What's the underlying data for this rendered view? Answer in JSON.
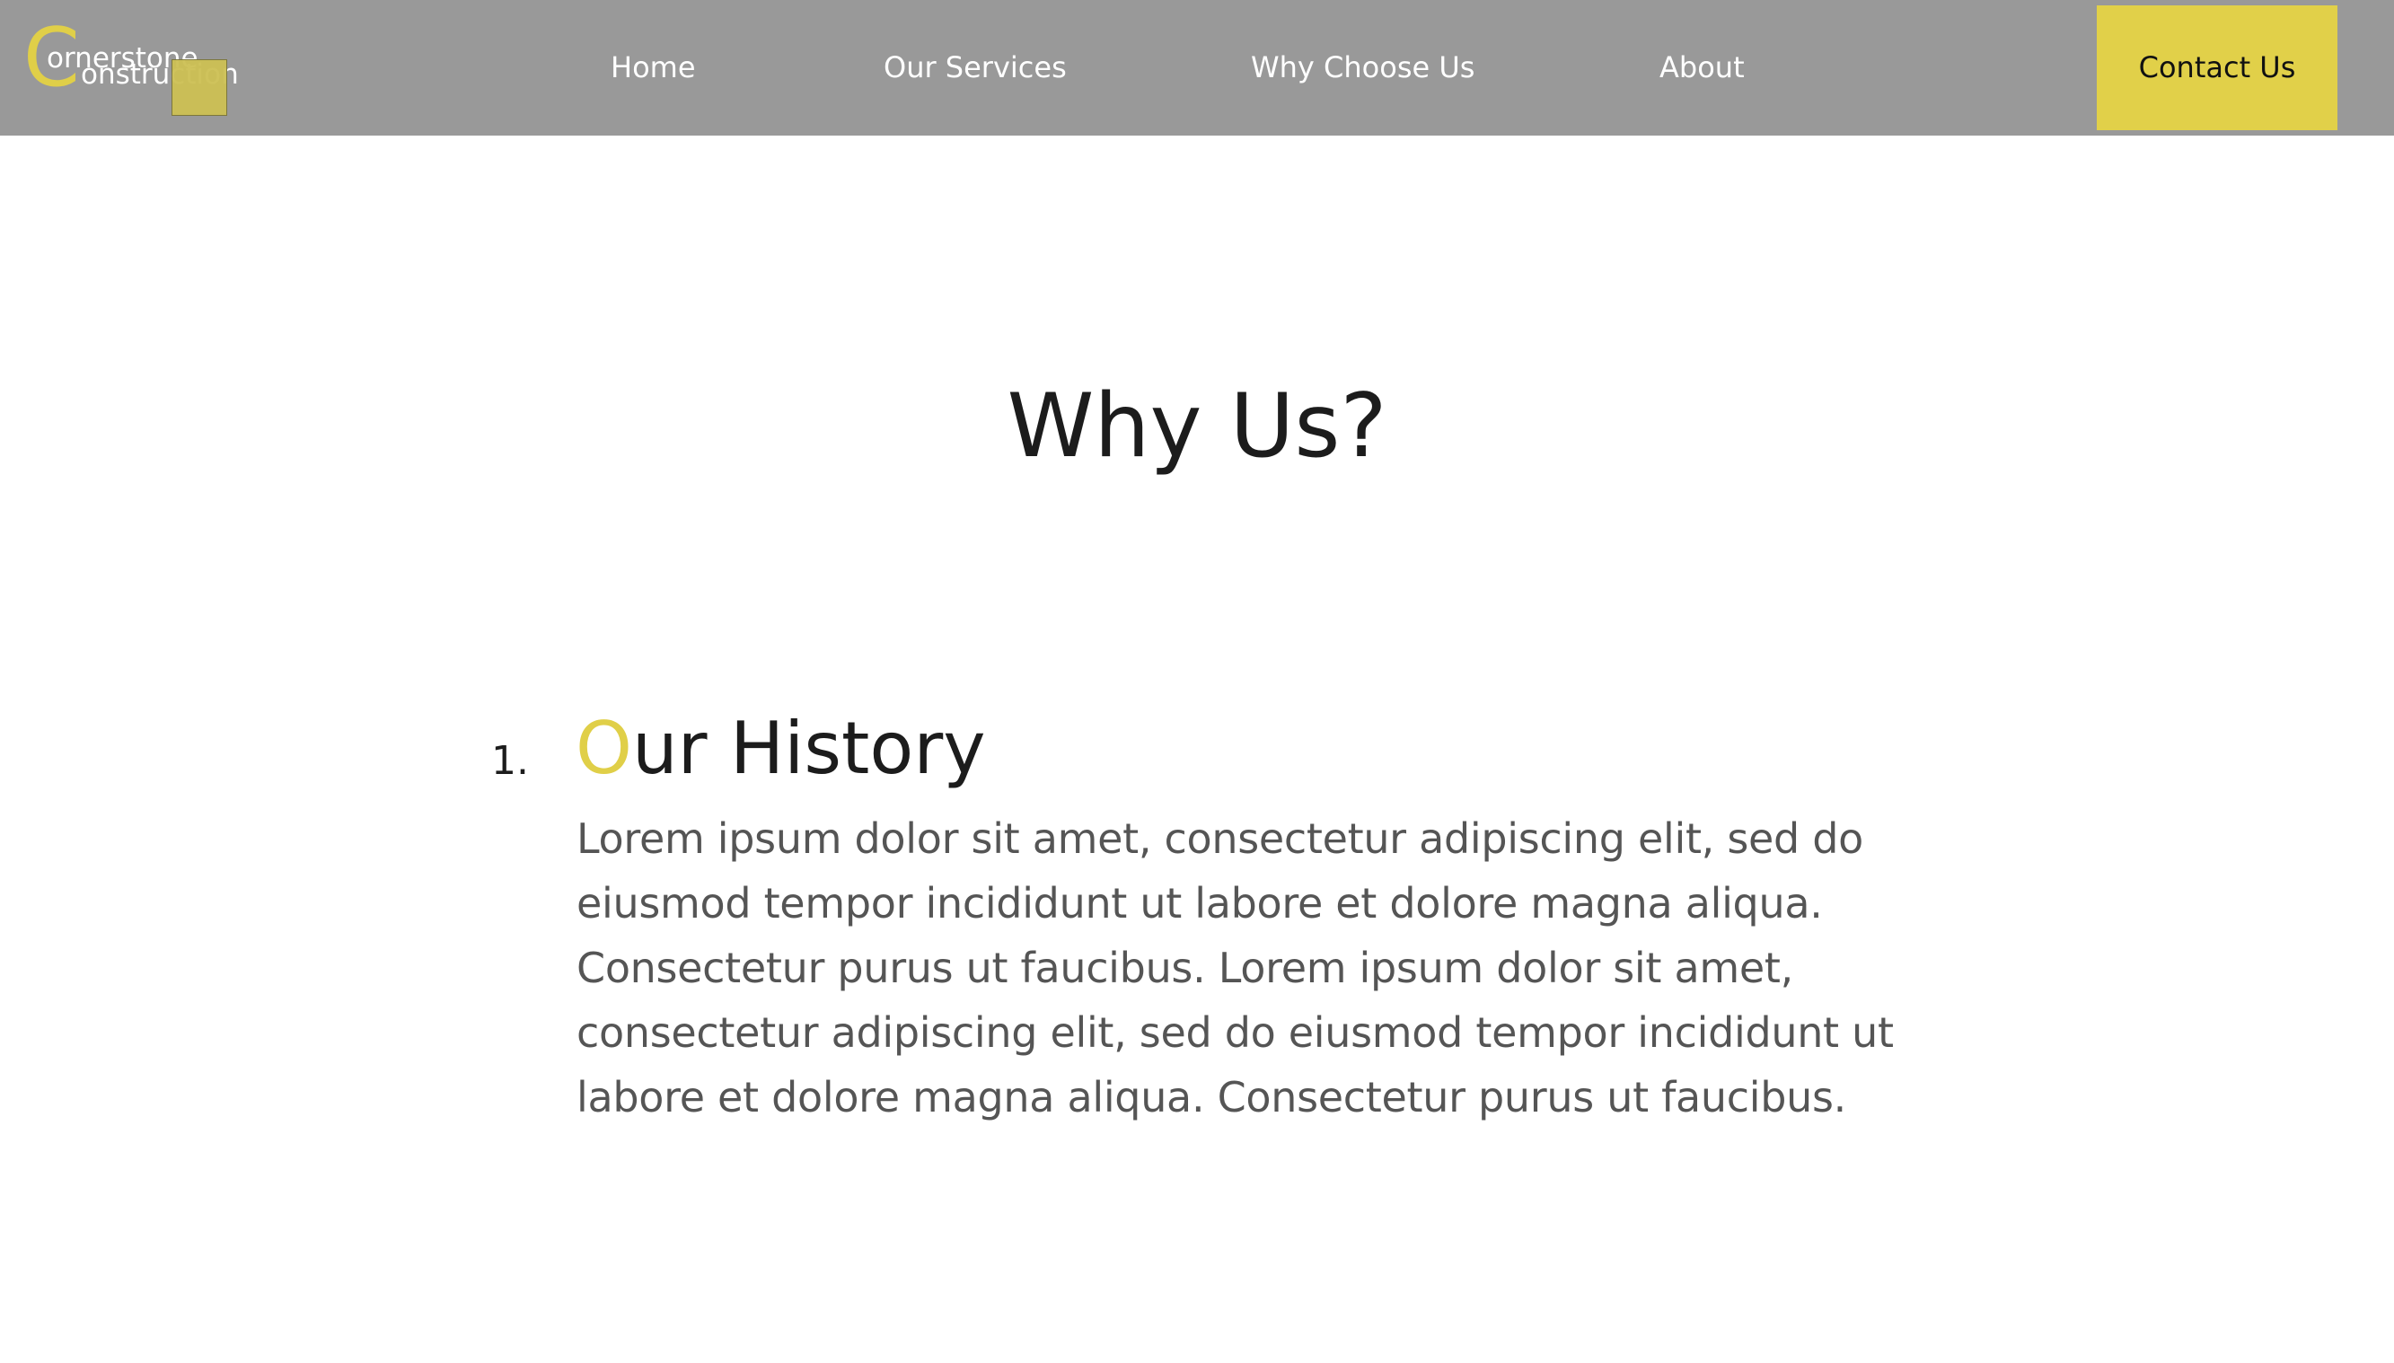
{
  "navbar": {
    "logo": {
      "initial": "C",
      "line1": "ornerstone",
      "line2": "onstruction"
    },
    "links": [
      {
        "label": "Home"
      },
      {
        "label": "Our Services"
      },
      {
        "label": "Why Choose Us"
      },
      {
        "label": "About"
      }
    ],
    "contact_label": "Contact Us"
  },
  "main": {
    "title": "Why Us?",
    "items": [
      {
        "number": "1.",
        "heading_initial": "O",
        "heading_rest": "ur History",
        "body": "Lorem ipsum dolor sit amet, consectetur adipiscing elit, sed do eiusmod tempor incididunt ut labore et dolore magna aliqua. Consectetur purus ut faucibus. Lorem ipsum dolor sit amet, consectetur adipiscing elit, sed do eiusmod tempor incididunt ut labore et dolore magna aliqua. Consectetur purus ut faucibus."
      }
    ]
  },
  "colors": {
    "navbar_bg": "#999999",
    "accent": "#e1d049",
    "heading_text": "#1c1c1c",
    "body_text": "#555555"
  }
}
